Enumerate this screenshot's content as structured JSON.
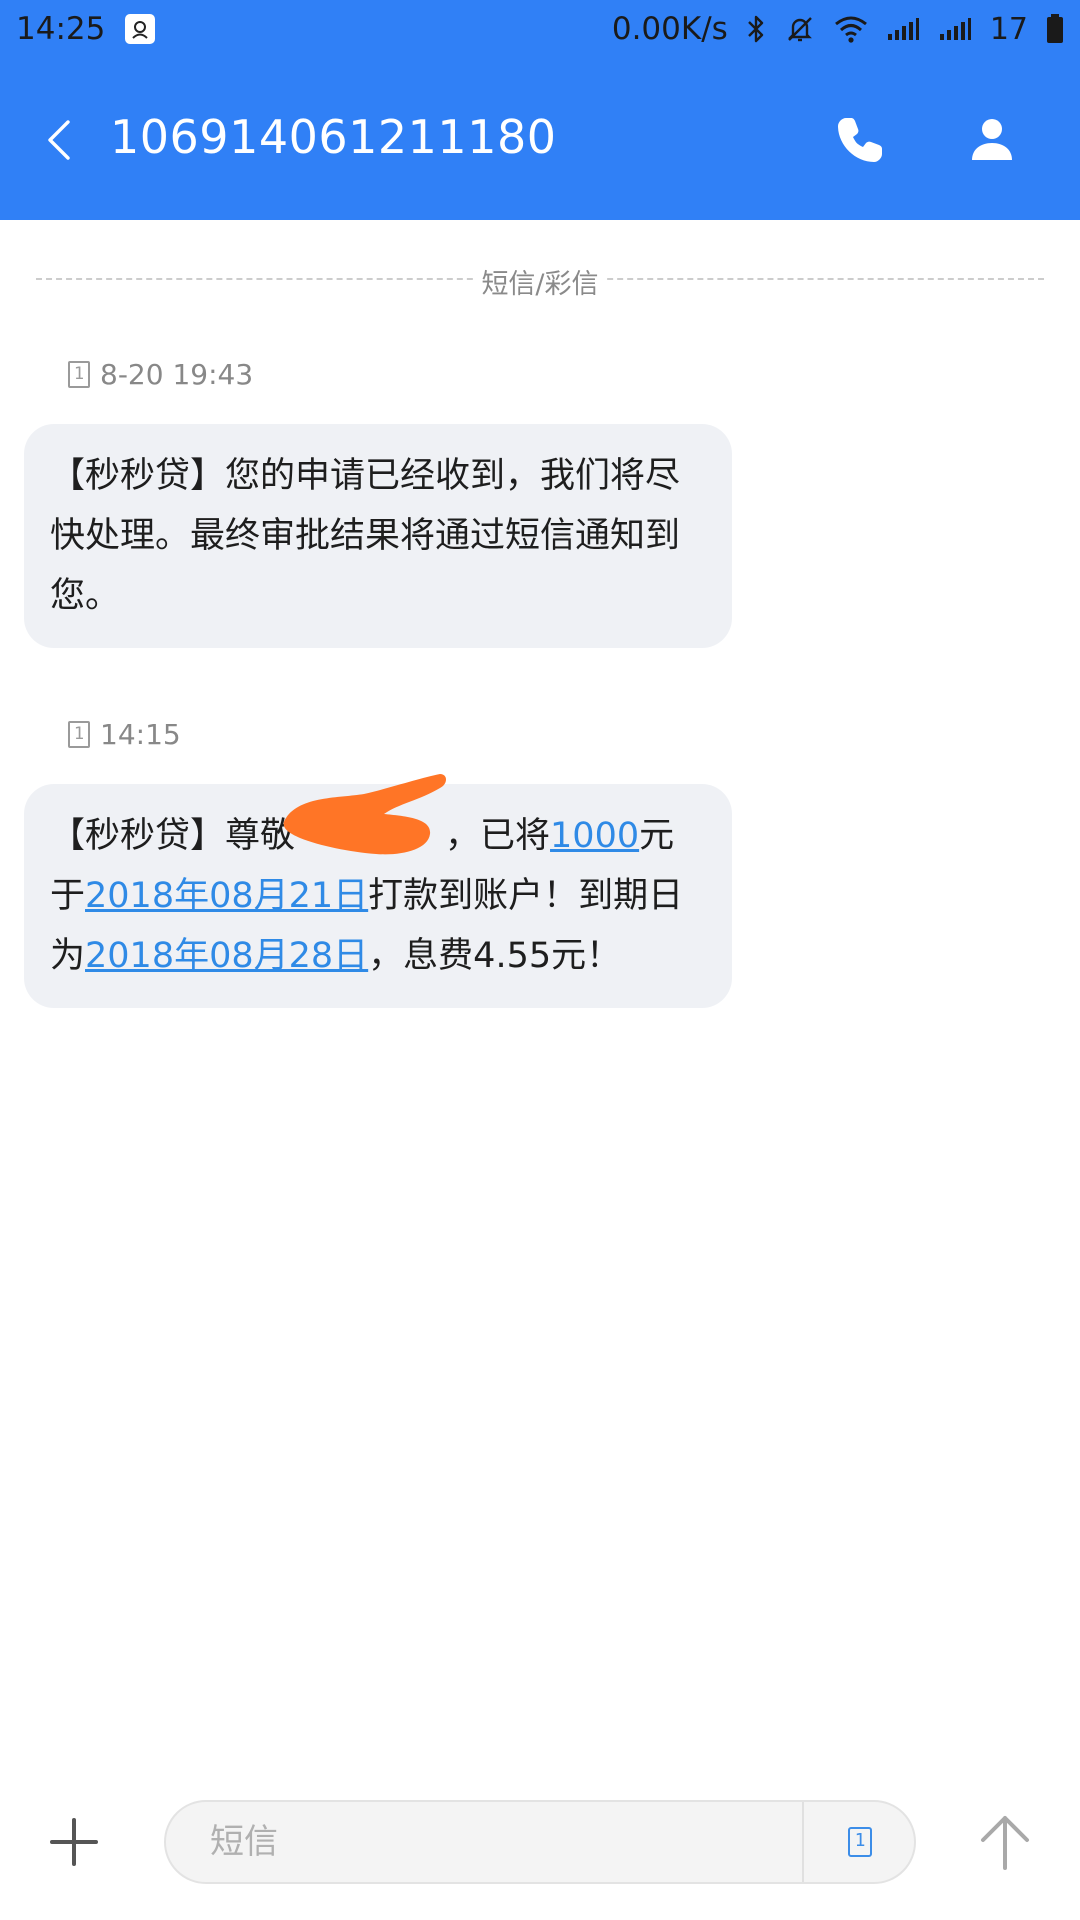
{
  "status_bar": {
    "time": "14:25",
    "network_speed": "0.00K/s",
    "battery_level": "17",
    "icons": [
      "notification-app-icon",
      "bluetooth-icon",
      "mute-icon",
      "wifi-icon",
      "signal-icon",
      "signal-icon",
      "battery-icon"
    ]
  },
  "app_bar": {
    "title": "106914061211180",
    "icons": [
      "back-arrow-icon",
      "phone-icon",
      "contact-person-icon"
    ]
  },
  "conversation": {
    "type_label": "短信/彩信",
    "messages": [
      {
        "time": "8-20 19:43",
        "sim": "1",
        "text": "【秒秒贷】您的申请已经收到，我们将尽快处理。最终审批结果将通过短信通知到您。"
      },
      {
        "time": "14:15",
        "sim": "1",
        "segments": {
          "t1": "【秒秒贷】尊敬",
          "t2": "，已将",
          "amount": "1000",
          "t3": "元于",
          "date1": "2018年08月21日",
          "t4": "打款到账户！到期日为",
          "date2": "2018年08月28日",
          "t5": "，息费4.55元！"
        }
      }
    ]
  },
  "composer": {
    "placeholder": "短信",
    "value": "",
    "sim": "1",
    "icons": [
      "plus-icon",
      "sim-card-icon",
      "send-arrow-up-icon"
    ]
  },
  "colors": {
    "header": "#3080f6",
    "bubble": "#eff1f5",
    "link": "#2f8ae6",
    "redaction": "#ff7526"
  }
}
